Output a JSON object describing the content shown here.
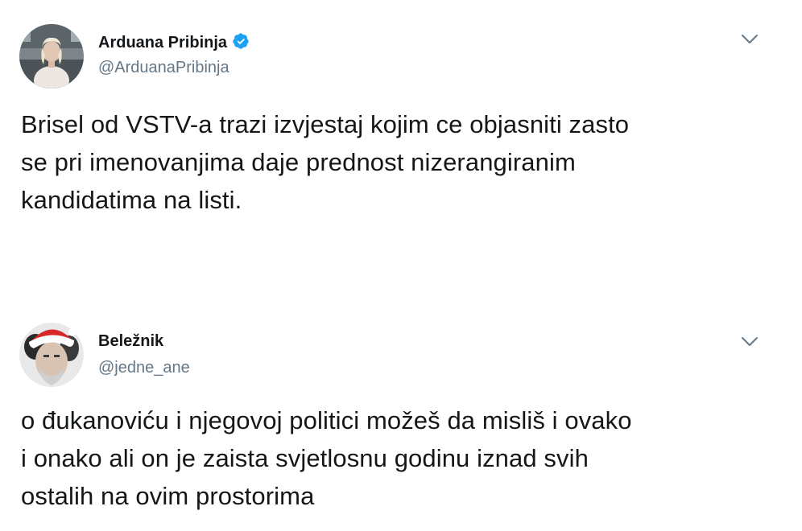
{
  "tweets": [
    {
      "display_name": "Arduana Pribinja",
      "handle": "@ArduanaPribinja",
      "verified": true,
      "text": "Brisel od VSTV-a trazi izvjestaj kojim ce objasniti zasto\nse pri imenovanjima daje prednost nizerangiranim\nkandidatima na listi.",
      "avatar_icon": "avatar-photo-woman",
      "menu_icon": "chevron-down-icon"
    },
    {
      "display_name": "Beležnik",
      "handle": "@jedne_ane",
      "verified": false,
      "text": "o đukanoviću i njegovoj politici možeš da misliš i ovako\ni onako ali on je zaista svjetlosnu godinu iznad svih\nostalih na ovim prostorima",
      "avatar_icon": "avatar-photo-man-santa-hat",
      "menu_icon": "chevron-down-icon"
    }
  ],
  "colors": {
    "text": "#14171a",
    "muted": "#657786",
    "verified_blue": "#1da1f2",
    "chevron": "#657786"
  }
}
